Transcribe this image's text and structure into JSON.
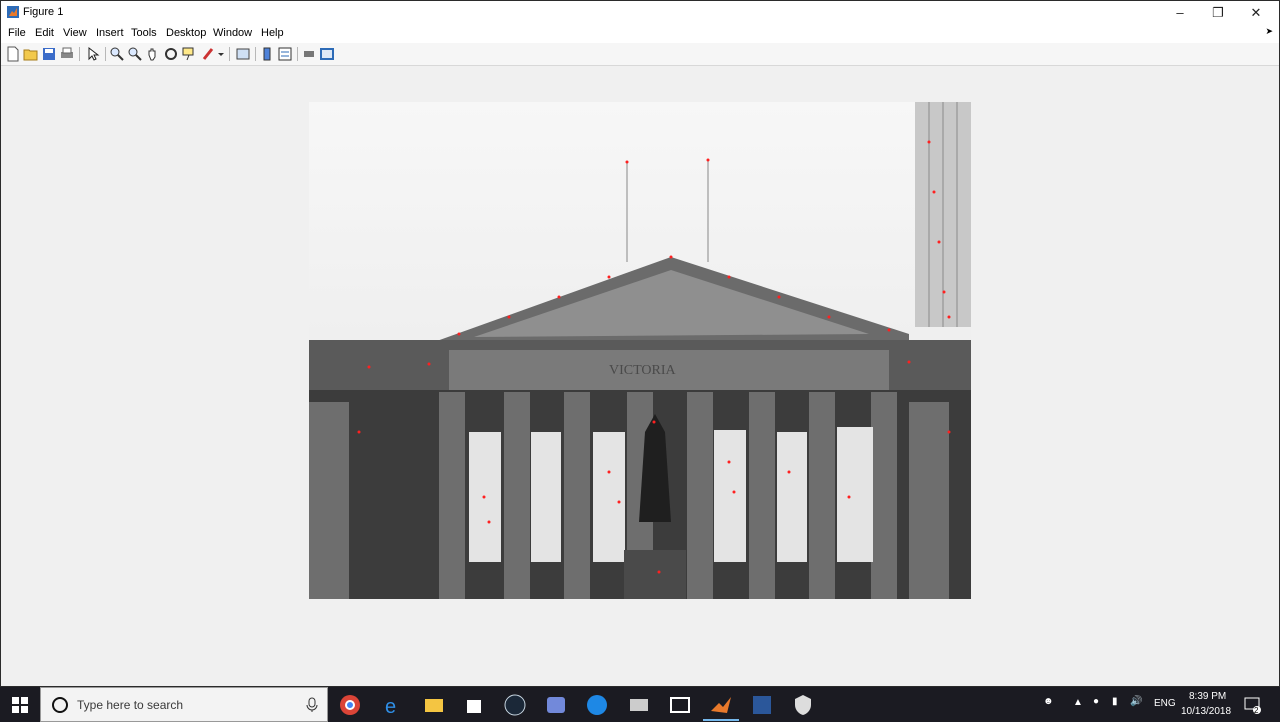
{
  "window": {
    "title": "Figure 1"
  },
  "menu": [
    "File",
    "Edit",
    "View",
    "Insert",
    "Tools",
    "Desktop",
    "Window",
    "Help"
  ],
  "toolbar_icons": [
    "new-figure-icon",
    "open-file-icon",
    "save-icon",
    "print-icon",
    "edit-plot-icon",
    "zoom-in-icon",
    "zoom-out-icon",
    "pan-icon",
    "rotate-3d-icon",
    "data-cursor-icon",
    "brush-icon",
    "brush-dropdown-icon",
    "link-plot-icon",
    "insert-colorbar-icon",
    "insert-legend-icon",
    "hide-plot-tools-icon",
    "show-plot-tools-icon"
  ],
  "image": {
    "building_text": "VICTORIA",
    "marker_color": "#ff2020"
  },
  "taskbar": {
    "search_placeholder": "Type here to search",
    "language": "ENG",
    "time": "8:39 PM",
    "date": "10/13/2018",
    "notification_count": "2",
    "apps": [
      "chrome",
      "edge",
      "file-explorer",
      "store",
      "steam",
      "discord",
      "app-g",
      "terminal",
      "photos",
      "matlab",
      "word",
      "app-shield"
    ],
    "active_app": "matlab"
  },
  "colors": {
    "accent": "#76b9ed",
    "taskbar": "#1b1b22",
    "figure_bg": "#f0f0f0"
  }
}
